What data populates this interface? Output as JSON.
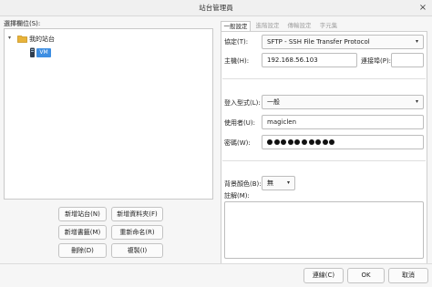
{
  "window": {
    "title": "站台管理員",
    "close_icon": "×"
  },
  "left": {
    "select_entry_label": "選擇欄位(S):",
    "tree": {
      "root_label": "我的站台",
      "site_label": "VM"
    },
    "buttons": {
      "new_site": "新增站台(N)",
      "new_folder": "新增資料夾(F)",
      "new_bookmark": "新增書籤(M)",
      "rename": "重新命名(R)",
      "delete": "刪除(D)",
      "duplicate": "複製(I)"
    }
  },
  "tabs": [
    {
      "label": "一般設定",
      "active": true
    },
    {
      "label": "進階設定",
      "active": false
    },
    {
      "label": "傳輸設定",
      "active": false
    },
    {
      "label": "字元集",
      "active": false
    }
  ],
  "general": {
    "protocol_label": "協定(T):",
    "protocol_value": "SFTP - SSH File Transfer Protocol",
    "host_label": "主機(H):",
    "host_value": "192.168.56.103",
    "port_label": "連接埠(P):",
    "port_value": "",
    "logon_type_label": "登入型式(L):",
    "logon_type_value": "一般",
    "user_label": "使用者(U):",
    "user_value": "magiclen",
    "password_label": "密碼(W):",
    "password_mask_count": 10,
    "bg_color_label": "背景顏色(B):",
    "bg_color_value": "無",
    "comments_label": "註解(M):"
  },
  "footer": {
    "connect": "連線(C)",
    "ok": "OK",
    "cancel": "取消"
  },
  "colors": {
    "selection": "#3d8ee2",
    "folder": "#e8b33a"
  },
  "icons": {
    "dropdown": "▾",
    "expand": "▾"
  }
}
